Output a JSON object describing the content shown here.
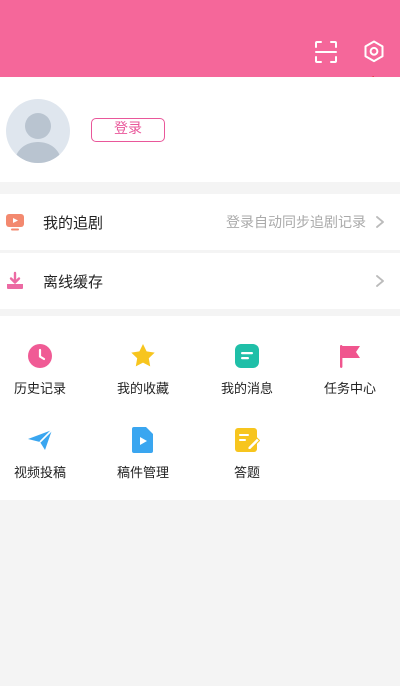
{
  "header": {
    "bg_color": "#f5679a",
    "icons": {
      "scan": "scan-icon",
      "settings": "settings-gear-icon"
    }
  },
  "profile": {
    "login_label": "登录",
    "accent_color": "#e9579a"
  },
  "rows": [
    {
      "label": "我的追剧",
      "hint": "登录自动同步追剧记录",
      "icon": "tv-icon"
    },
    {
      "label": "离线缓存",
      "hint": "",
      "icon": "download-icon"
    }
  ],
  "grid": [
    {
      "label": "历史记录",
      "icon": "clock-icon",
      "color": "#f05b95"
    },
    {
      "label": "我的收藏",
      "icon": "star-icon",
      "color": "#f7c51e"
    },
    {
      "label": "我的消息",
      "icon": "message-icon",
      "color": "#1fbfa8"
    },
    {
      "label": "任务中心",
      "icon": "flag-icon",
      "color": "#f0558e"
    },
    {
      "label": "视频投稿",
      "icon": "paper-plane-icon",
      "color": "#3aa6f0"
    },
    {
      "label": "稿件管理",
      "icon": "video-file-icon",
      "color": "#3aa6f0"
    },
    {
      "label": "答题",
      "icon": "quiz-edit-icon",
      "color": "#f7c51e"
    }
  ]
}
